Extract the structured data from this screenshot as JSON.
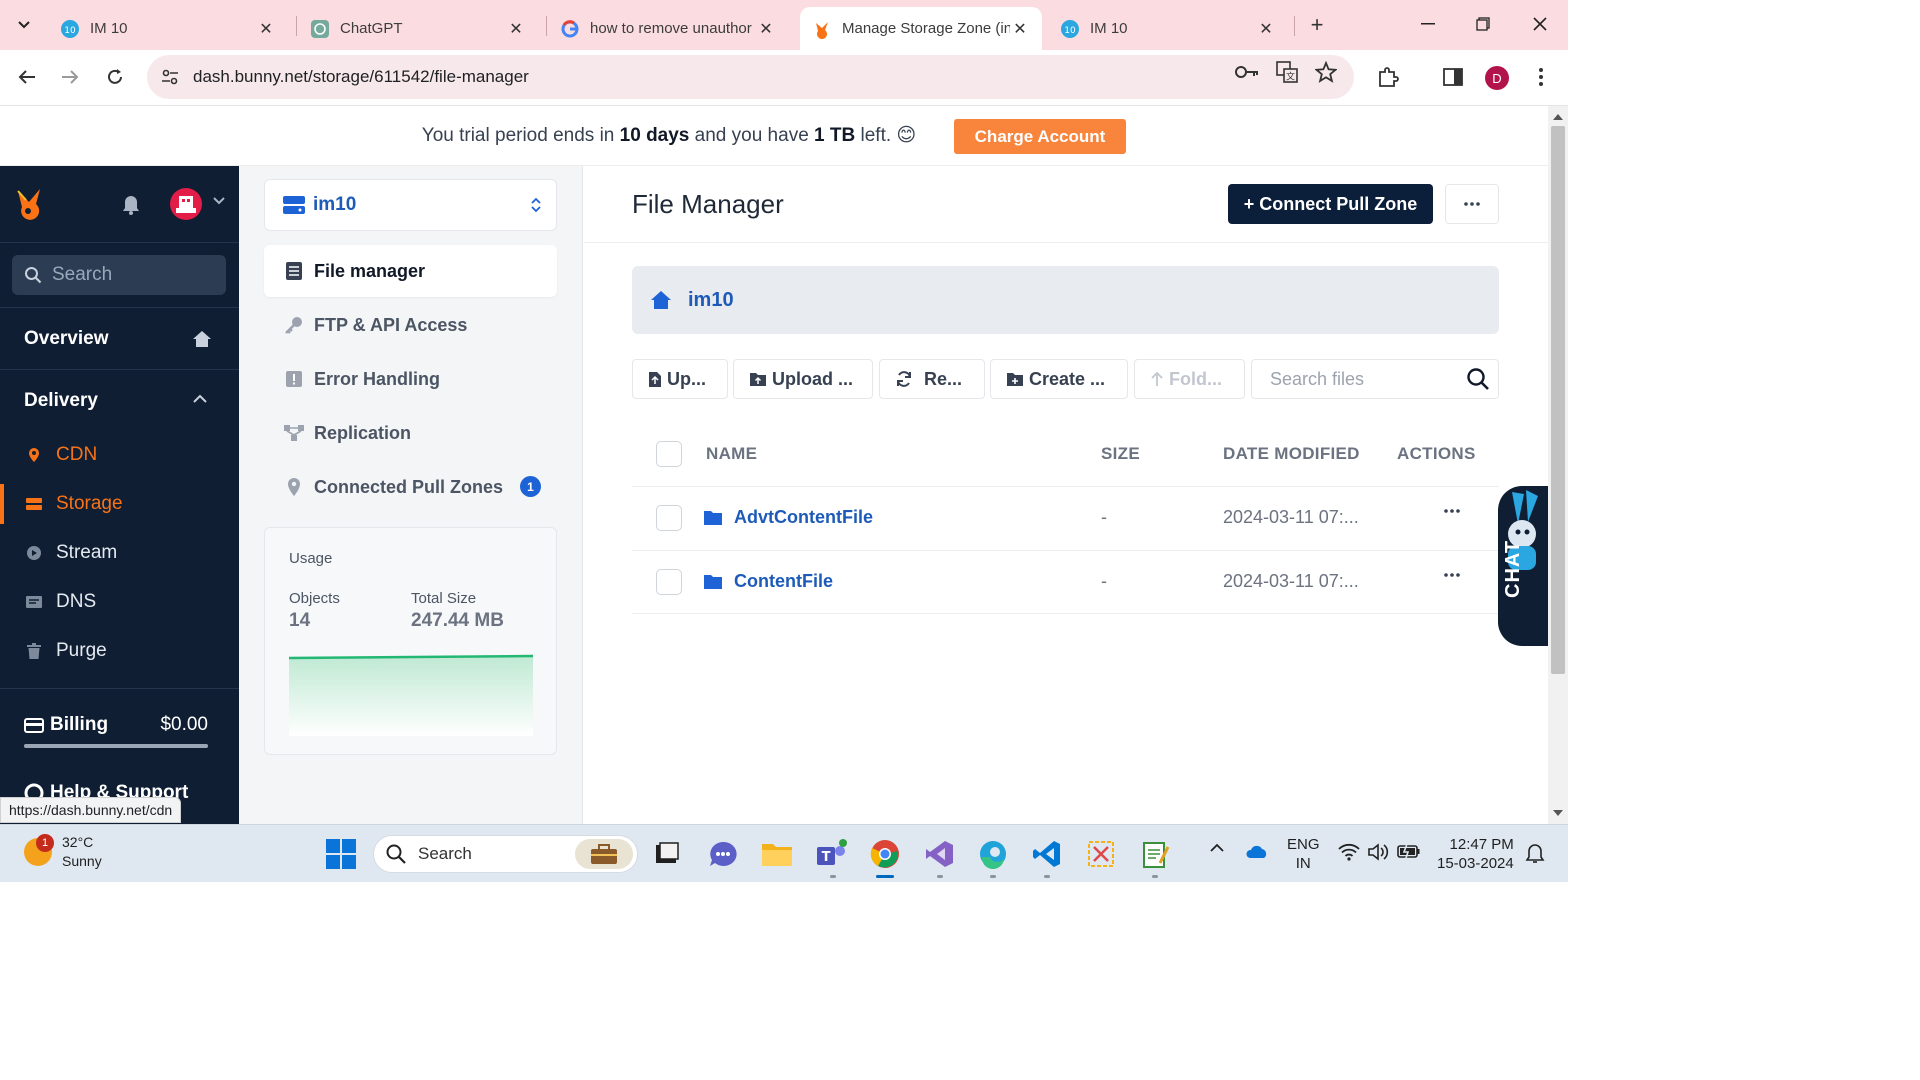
{
  "browser": {
    "tabs": [
      {
        "title": "IM 10",
        "active": false
      },
      {
        "title": "ChatGPT",
        "active": false
      },
      {
        "title": "how to remove unauthor",
        "active": false
      },
      {
        "title": "Manage Storage Zone (in",
        "active": true
      },
      {
        "title": "IM 10",
        "active": false
      }
    ],
    "url": "dash.bunny.net/storage/611542/file-manager",
    "profile_initial": "D",
    "status_url": "https://dash.bunny.net/cdn"
  },
  "banner": {
    "pre": "You trial period ends in ",
    "days": "10 days",
    "mid": " and you have ",
    "amount": "1 TB",
    "post": " left. 😊",
    "charge_label": "Charge Account"
  },
  "sidebar": {
    "search_placeholder": "Search",
    "overview_label": "Overview",
    "delivery_label": "Delivery",
    "items": [
      {
        "label": "CDN",
        "icon": "pin-icon"
      },
      {
        "label": "Storage",
        "icon": "storage-icon"
      },
      {
        "label": "Stream",
        "icon": "play-icon"
      },
      {
        "label": "DNS",
        "icon": "dns-icon"
      },
      {
        "label": "Purge",
        "icon": "trash-icon"
      }
    ],
    "billing_label": "Billing",
    "billing_amount": "$0.00",
    "help_label": "Help & Support"
  },
  "storage_nav": {
    "zone_name": "im10",
    "items": [
      {
        "label": "File manager"
      },
      {
        "label": "FTP & API Access"
      },
      {
        "label": "Error Handling"
      },
      {
        "label": "Replication"
      },
      {
        "label": "Connected Pull Zones",
        "badge": "1"
      }
    ],
    "usage": {
      "title": "Usage",
      "objects_label": "Objects",
      "objects_value": "14",
      "size_label": "Total Size",
      "size_value": "247.44 MB"
    }
  },
  "main": {
    "title": "File Manager",
    "connect_label": "+ Connect Pull Zone",
    "breadcrumb": "im10",
    "actions": {
      "upload": "Up...",
      "upload_folder": "Upload ...",
      "refresh": "Re...",
      "create": "Create ...",
      "folder_up": "Fold..."
    },
    "search_placeholder": "Search files",
    "columns": {
      "name": "NAME",
      "size": "SIZE",
      "date": "DATE MODIFIED",
      "actions": "ACTIONS"
    },
    "rows": [
      {
        "name": "AdvtContentFile",
        "size": "-",
        "date": "2024-03-11 07:..."
      },
      {
        "name": "ContentFile",
        "size": "-",
        "date": "2024-03-11 07:..."
      }
    ],
    "chat_label": "CHAT"
  },
  "taskbar": {
    "notification_count": "1",
    "temperature": "32°C",
    "weather": "Sunny",
    "search_label": "Search",
    "lang_line1": "ENG",
    "lang_line2": "IN",
    "time": "12:47 PM",
    "date": "15-03-2024"
  },
  "colors": {
    "accent_orange": "#f9843b",
    "sidebar_bg": "#0f1e33",
    "link_blue": "#1e5bb8",
    "tabstrip_pink": "#fbdde1"
  }
}
